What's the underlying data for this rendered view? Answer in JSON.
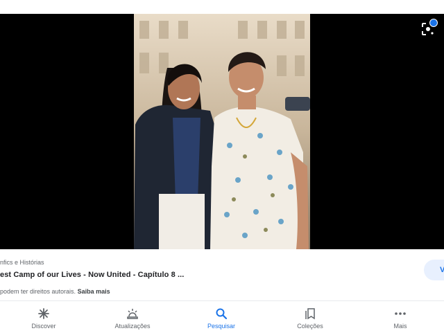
{
  "colors": {
    "accent": "#1a73e8",
    "viewer_bg": "#000000",
    "text_secondary": "#5f6368"
  },
  "viewer": {
    "image_alt": "",
    "lens_icon": "lens-icon"
  },
  "result": {
    "source": "nfics e Histórias",
    "title": "est Camp of our Lives - Now United - Capítulo 8 ...",
    "rights_text": "podem ter direitos autorais.",
    "learn_more": "Saiba mais",
    "visit_label": "V"
  },
  "nav": {
    "items": [
      {
        "label": "Discover",
        "icon": "asterisk-icon",
        "active": false
      },
      {
        "label": "Atualizações",
        "icon": "updates-icon",
        "active": false
      },
      {
        "label": "Pesquisar",
        "icon": "search-icon",
        "active": true
      },
      {
        "label": "Coleções",
        "icon": "collections-icon",
        "active": false
      },
      {
        "label": "Mais",
        "icon": "more-icon",
        "active": false
      }
    ]
  }
}
